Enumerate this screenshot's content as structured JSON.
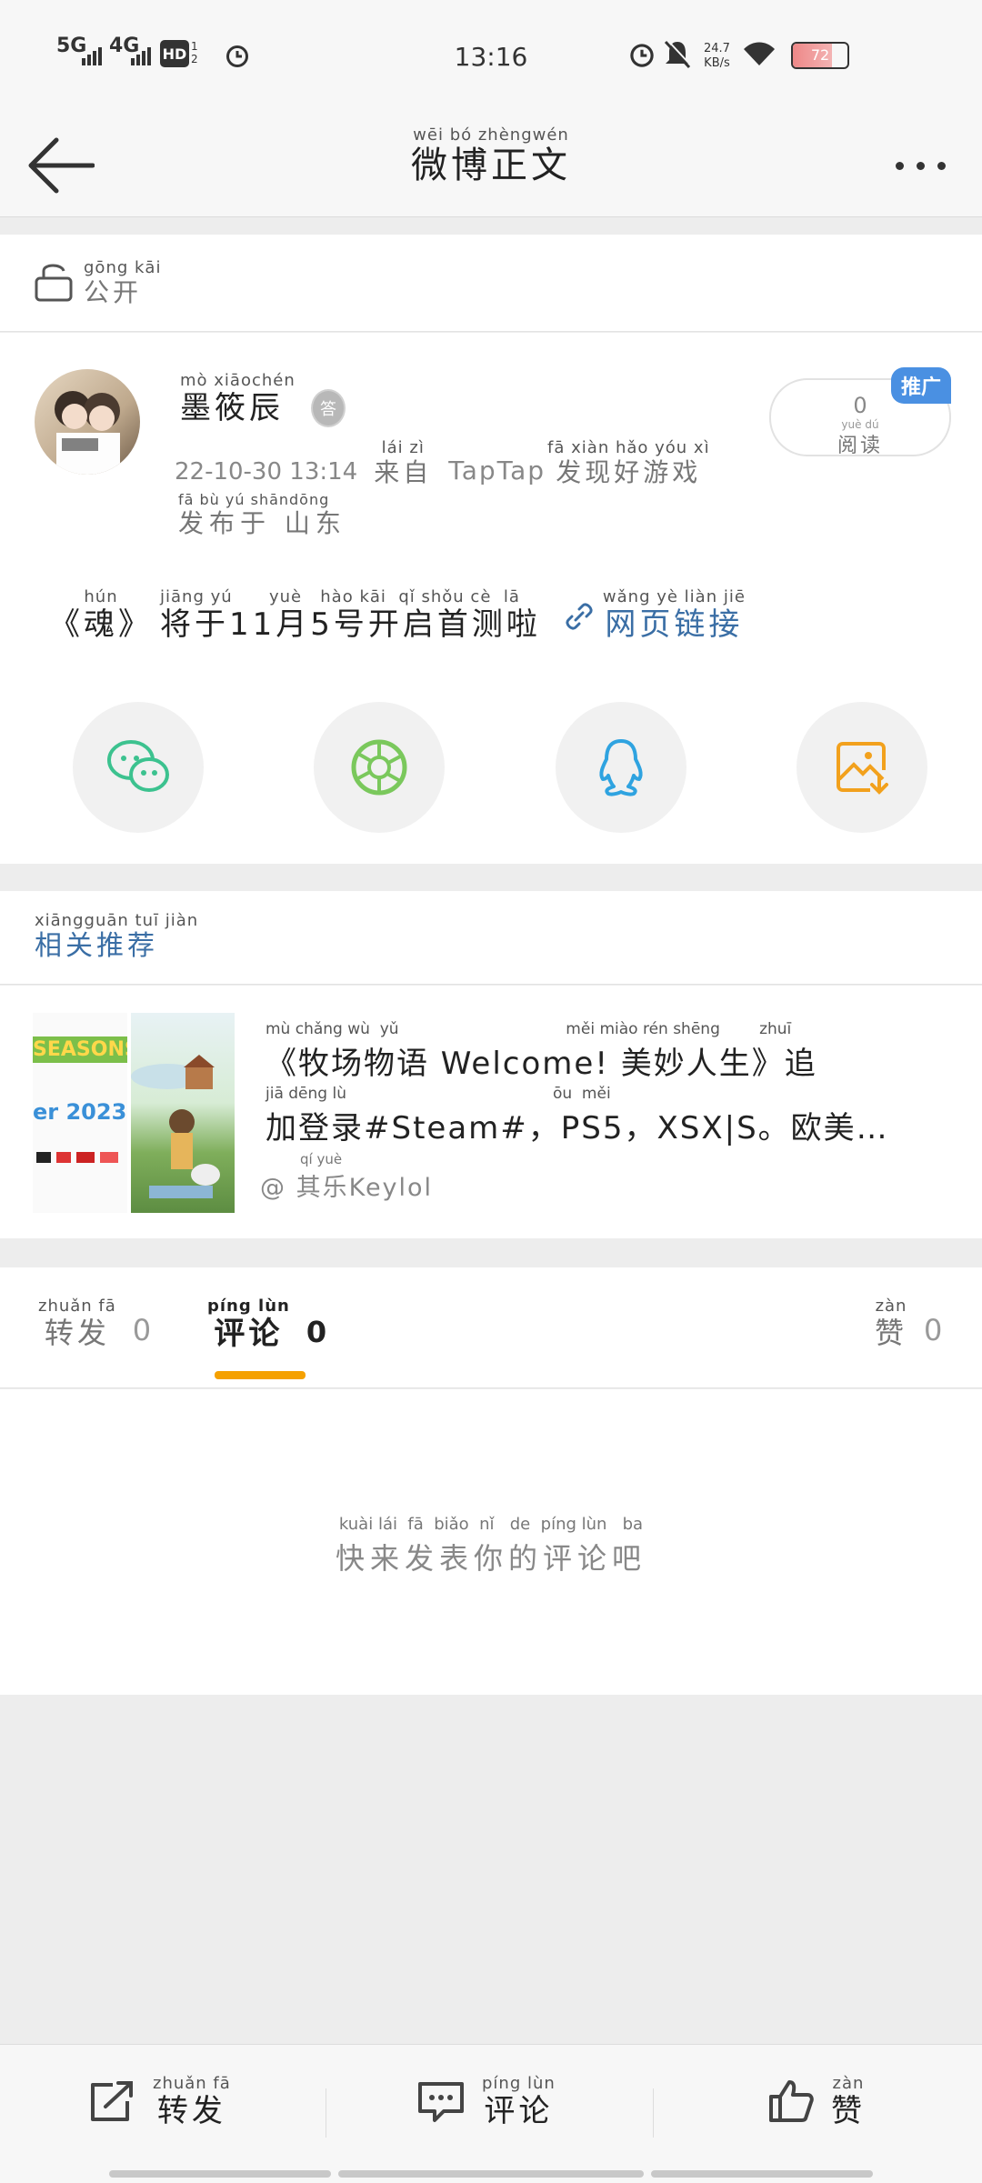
{
  "status": {
    "net1": "5G",
    "net2": "4G",
    "hd": "HD",
    "hd_sub": "1\n2",
    "time": "13:16",
    "speed": "24.7",
    "speed_unit": "KB/s",
    "battery": "72"
  },
  "nav": {
    "title_pinyin": "wēi bó zhèngwén",
    "title": "微博正文"
  },
  "visibility": {
    "pinyin": "gōng kāi",
    "label": "公开"
  },
  "post": {
    "author_pinyin": "mò xiāochén",
    "author": "墨筱辰",
    "badge": "答",
    "read_count": "0",
    "read_pinyin": "yuè dú",
    "read_label": "阅读",
    "promo_badge": "推广",
    "timestamp": "22-10-30 13:14",
    "source_pinyin_from": "lái zì",
    "source_from": "来自",
    "source_app": "TapTap",
    "source_suffix_pinyin": "fā xiàn hǎo yóu xì",
    "source_suffix": "发现好游戏",
    "location_pinyin": "fā bù yú  shāndōng",
    "location": "发布于 山东",
    "content_p1": "《魂》",
    "content_p1_pinyin": "hún",
    "content_p2": "将于11月5号开启首测啦",
    "content_p2_pinyin": "jiāng yú      yuè   hào kāi  qǐ shǒu cè  lā",
    "link_pinyin": "wǎng yè  liàn  jiē",
    "link_label": "网页链接"
  },
  "share": {
    "items": [
      "wechat-icon",
      "moments-icon",
      "qq-icon",
      "save-image-icon"
    ],
    "colors": {
      "wechat": "#3cc28f",
      "moments": "#7ac85c",
      "qq": "#2fa3e0",
      "save": "#f2a11d"
    }
  },
  "related": {
    "header_pinyin": "xiāngguān tuī jiàn",
    "header": "相关推荐",
    "item": {
      "line1_pinyin": "mù chǎng wù  yǔ                                  měi miào rén shēng        zhuī",
      "line1": "《牧场物语 Welcome! 美妙人生》追",
      "line2_pinyin": "jiā dēng lù                                          ōu  měi",
      "line2": "加登录#Steam#，PS5，XSX|S。欧美…",
      "source_pinyin": "qí  yuè",
      "source": "@ 其乐Keylol",
      "thumb_text1": "SEASONS",
      "thumb_text2": "er 2023"
    }
  },
  "tabs": {
    "repost_pinyin": "zhuǎn  fā",
    "repost": "转发",
    "repost_count": "0",
    "comment_pinyin": "píng lùn",
    "comment": "评论",
    "comment_count": "0",
    "like_pinyin": "zàn",
    "like": "赞",
    "like_count": "0"
  },
  "empty": {
    "pinyin": "kuài lái  fā  biǎo  nǐ   de  píng lùn   ba",
    "text": "快来发表你的评论吧"
  },
  "bottom": {
    "repost_pinyin": "zhuǎn  fā",
    "repost": "转发",
    "comment_pinyin": "píng lùn",
    "comment": "评论",
    "like_pinyin": "zàn",
    "like": "赞"
  }
}
